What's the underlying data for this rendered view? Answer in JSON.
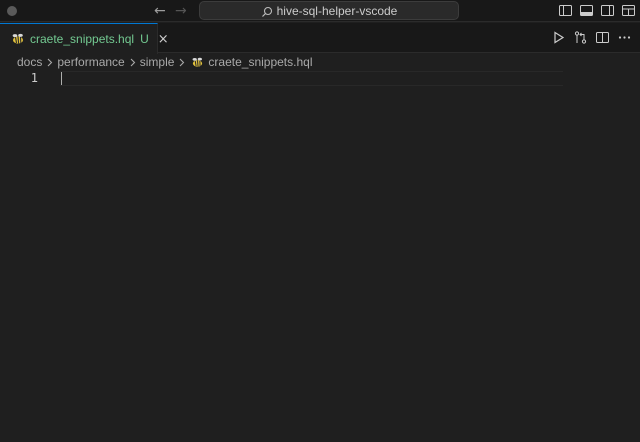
{
  "titlebar": {
    "command_center_label": "hive-sql-helper-vscode",
    "back_glyph": "←",
    "forward_glyph": "→"
  },
  "tab": {
    "title": "craete_snippets.hql",
    "badge": "U",
    "close_glyph": "×",
    "title_color": "#73c991"
  },
  "breadcrumbs": {
    "items": [
      "docs",
      "performance",
      "simple",
      "craete_snippets.hql"
    ]
  },
  "editor": {
    "line_numbers": [
      "1"
    ]
  },
  "icons": {
    "file_icon": "hive-bee-icon",
    "layout": [
      "toggle-primary-sidebar-icon",
      "toggle-panel-icon",
      "toggle-secondary-sidebar-icon",
      "customize-layout-icon"
    ],
    "editor_actions": [
      "run-icon",
      "open-changes-icon",
      "split-editor-icon",
      "more-actions-icon"
    ]
  },
  "colors": {
    "accent": "#0078d4",
    "background": "#1f1f1f",
    "titlebar": "#181818"
  }
}
